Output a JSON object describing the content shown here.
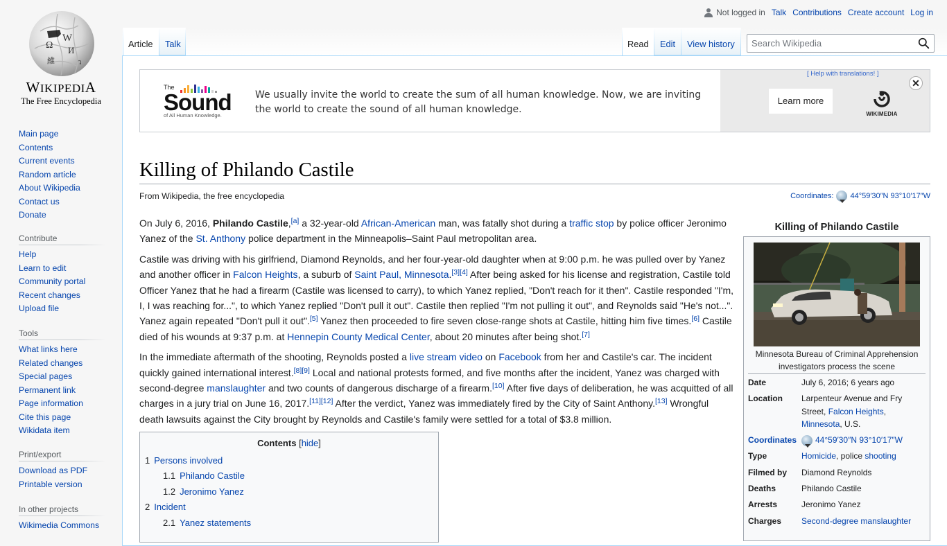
{
  "logo": {
    "wordmark_first": "W",
    "wordmark_rest": "IKIPEDI",
    "wordmark_last": "A",
    "tagline": "The Free Encyclopedia"
  },
  "personal": {
    "status": "Not logged in",
    "links": [
      "Talk",
      "Contributions",
      "Create account",
      "Log in"
    ]
  },
  "tabs": {
    "left": [
      "Article",
      "Talk"
    ],
    "right": [
      "Read",
      "Edit",
      "View history"
    ],
    "selected_left": "Article",
    "selected_right": "Read"
  },
  "search": {
    "placeholder": "Search Wikipedia",
    "value": ""
  },
  "sidebar": {
    "navigation": [
      "Main page",
      "Contents",
      "Current events",
      "Random article",
      "About Wikipedia",
      "Contact us",
      "Donate"
    ],
    "contribute": {
      "heading": "Contribute",
      "items": [
        "Help",
        "Learn to edit",
        "Community portal",
        "Recent changes",
        "Upload file"
      ]
    },
    "tools": {
      "heading": "Tools",
      "items": [
        "What links here",
        "Related changes",
        "Special pages",
        "Permanent link",
        "Page information",
        "Cite this page",
        "Wikidata item"
      ]
    },
    "print": {
      "heading": "Print/export",
      "items": [
        "Download as PDF",
        "Printable version"
      ]
    },
    "projects": {
      "heading": "In other projects",
      "items": [
        "Wikimedia Commons"
      ]
    }
  },
  "banner": {
    "logo_the": "The",
    "logo_word": "Sound",
    "logo_sub": "of All Human Knowledge.",
    "bar_colors": [
      "#e33",
      "#f7941d",
      "#fbb03b",
      "#8dc63f",
      "#2e3192",
      "#3bb3e6",
      "#8b4fa3",
      "#ec008c",
      "#00a99d",
      "#d4d4d4",
      "#999"
    ],
    "message": "We usually invite the world to create the sum of all human knowledge. Now, we are inviting the world to create the sound of all human knowledge.",
    "help_link": "[ Help with translations! ]",
    "learn_more": "Learn more",
    "wikimedia": "WIKIMEDIA",
    "close": "✕"
  },
  "article": {
    "title": "Killing of Philando Castile",
    "site_sub": "From Wikipedia, the free encyclopedia",
    "coordinates_label": "Coordinates:",
    "coordinates_value": "44°59′30″N 93°10′17″W",
    "paragraphs": [
      [
        {
          "t": "On July 6, 2016, "
        },
        {
          "t": "Philando Castile",
          "b": true
        },
        {
          "t": ","
        },
        {
          "sup": "[a]"
        },
        {
          "t": " a 32-year-old "
        },
        {
          "link": "African-American"
        },
        {
          "t": " man, was fatally shot during a "
        },
        {
          "link": "traffic stop"
        },
        {
          "t": " by police officer Jeronimo Yanez of the "
        },
        {
          "link": "St. Anthony"
        },
        {
          "t": " police department in the Minneapolis–Saint Paul metropolitan area."
        }
      ],
      [
        {
          "t": "Castile was driving with his girlfriend, Diamond Reynolds, and her four-year-old daughter when at 9:00 p.m. he was pulled over by Yanez and another officer in "
        },
        {
          "link": "Falcon Heights"
        },
        {
          "t": ", a suburb of "
        },
        {
          "link": "Saint Paul, Minnesota"
        },
        {
          "t": "."
        },
        {
          "sup": "[3]"
        },
        {
          "sup": "[4]"
        },
        {
          "t": " After being asked for his license and registration, Castile told Officer Yanez that he had a firearm (Castile was licensed to carry), to which Yanez replied, \"Don't reach for it then\". Castile responded \"I'm, I, I was reaching for...\", to which Yanez replied \"Don't pull it out\". Castile then replied \"I'm not pulling it out\", and Reynolds said \"He's not...\". Yanez again repeated \"Don't pull it out\"."
        },
        {
          "sup": "[5]"
        },
        {
          "t": " Yanez then proceeded to fire seven close-range shots at Castile, hitting him five times."
        },
        {
          "sup": "[6]"
        },
        {
          "t": " Castile died of his wounds at 9:37 p.m. at "
        },
        {
          "link": "Hennepin County Medical Center"
        },
        {
          "t": ", about 20 minutes after being shot."
        },
        {
          "sup": "[7]"
        }
      ],
      [
        {
          "t": "In the immediate aftermath of the shooting, Reynolds posted a "
        },
        {
          "link": "live stream video"
        },
        {
          "t": " on "
        },
        {
          "link": "Facebook"
        },
        {
          "t": " from her and Castile's car. The incident quickly gained international interest."
        },
        {
          "sup": "[8]"
        },
        {
          "sup": "[9]"
        },
        {
          "t": " Local and national protests formed, and five months after the incident, Yanez was charged with second-degree "
        },
        {
          "link": "manslaughter"
        },
        {
          "t": " and two counts of dangerous discharge of a firearm."
        },
        {
          "sup": "[10]"
        },
        {
          "t": " After five days of deliberation, he was acquitted of all charges in a jury trial on June 16, 2017."
        },
        {
          "sup": "[11]"
        },
        {
          "sup": "[12]"
        },
        {
          "t": " After the verdict, Yanez was immediately fired by the City of Saint Anthony."
        },
        {
          "sup": "[13]"
        },
        {
          "t": " Wrongful death lawsuits against the City brought by Reynolds and Castile's family were settled for a total of $3.8 million."
        }
      ]
    ]
  },
  "toc": {
    "title": "Contents",
    "toggle_open": "[",
    "toggle_label": "hide",
    "toggle_close": "]",
    "items": [
      {
        "num": "1",
        "label": "Persons involved",
        "level": 1
      },
      {
        "num": "1.1",
        "label": "Philando Castile",
        "level": 2
      },
      {
        "num": "1.2",
        "label": "Jeronimo Yanez",
        "level": 2
      },
      {
        "num": "2",
        "label": "Incident",
        "level": 1
      },
      {
        "num": "2.1",
        "label": "Yanez statements",
        "level": 2
      }
    ]
  },
  "infobox": {
    "title": "Killing of Philando Castile",
    "caption": "Minnesota Bureau of Criminal Apprehension investigators process the scene",
    "rows": [
      {
        "label": "Date",
        "value": [
          {
            "t": "July 6, 2016; 6 years ago"
          }
        ]
      },
      {
        "label": "Location",
        "value": [
          {
            "t": "Larpenteur Avenue and Fry Street, "
          },
          {
            "link": "Falcon Heights"
          },
          {
            "t": ", "
          },
          {
            "link": "Minnesota"
          },
          {
            "t": ", U.S."
          }
        ]
      },
      {
        "label": "Coordinates",
        "label_link": true,
        "globe": true,
        "value": [
          {
            "link": "44°59′30″N 93°10′17″W"
          }
        ]
      },
      {
        "label": "Type",
        "value": [
          {
            "link": "Homicide"
          },
          {
            "t": ", police "
          },
          {
            "link": "shooting"
          }
        ]
      },
      {
        "label": "Filmed by",
        "value": [
          {
            "t": "Diamond Reynolds"
          }
        ]
      },
      {
        "label": "Deaths",
        "value": [
          {
            "t": "Philando Castile"
          }
        ]
      },
      {
        "label": "Arrests",
        "value": [
          {
            "t": "Jeronimo Yanez"
          }
        ]
      },
      {
        "label": "Charges",
        "value": [
          {
            "link": "Second-degree manslaughter"
          }
        ]
      }
    ]
  }
}
